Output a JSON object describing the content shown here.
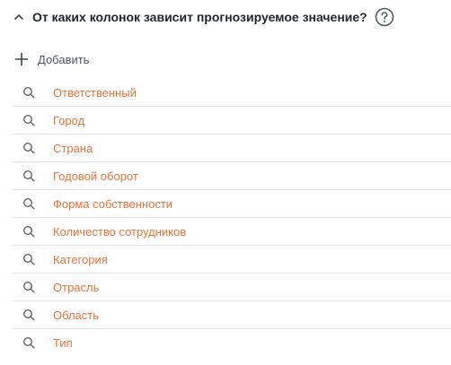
{
  "section": {
    "title": "От каких колонок зависит прогнозируемое значение?",
    "collapse_icon": "chevron-up-icon",
    "help_icon": "help-circle-icon"
  },
  "add_button": {
    "label": "Добавить",
    "icon": "plus-icon"
  },
  "columns": [
    {
      "label": "Ответственный",
      "icon": "search-icon"
    },
    {
      "label": "Город",
      "icon": "search-icon"
    },
    {
      "label": "Страна",
      "icon": "search-icon"
    },
    {
      "label": "Годовой оборот",
      "icon": "search-icon"
    },
    {
      "label": "Форма собственности",
      "icon": "search-icon"
    },
    {
      "label": "Количество сотрудников",
      "icon": "search-icon"
    },
    {
      "label": "Категория",
      "icon": "search-icon"
    },
    {
      "label": "Отрасль",
      "icon": "search-icon"
    },
    {
      "label": "Область",
      "icon": "search-icon"
    },
    {
      "label": "Тип",
      "icon": "search-icon"
    }
  ],
  "colors": {
    "accent": "#e8743b",
    "title": "#1f2530",
    "divider": "#e3e5e8",
    "icon": "#5f6673"
  }
}
